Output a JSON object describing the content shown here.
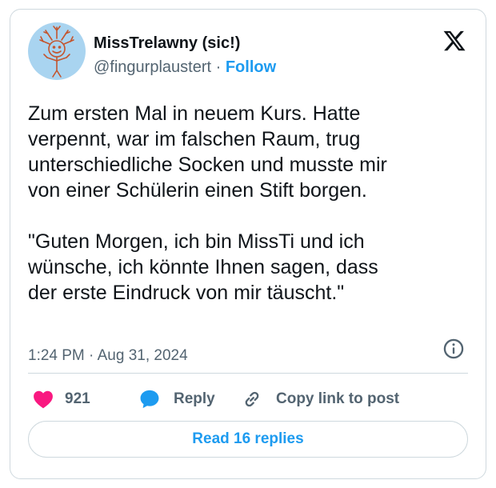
{
  "author": {
    "display_name": "MissTrelawny (sic!)",
    "handle": "@fingurplaustert",
    "separator": "·",
    "follow_label": "Follow"
  },
  "tweet": {
    "text": "Zum ersten Mal in neuem Kurs. Hatte\nverpennt, war im falschen Raum, trug\nunterschiedliche Socken und musste mir\nvon einer Schülerin einen Stift borgen.\n\n\"Guten Morgen, ich bin MissTi und ich\nwünsche, ich könnte Ihnen sagen, dass\nder erste Eindruck von mir täuscht.\"",
    "time": "1:24 PM",
    "date_separator": "·",
    "date": "Aug 31, 2024"
  },
  "actions": {
    "like_count": "921",
    "reply_label": "Reply",
    "copy_label": "Copy link to post"
  },
  "read_replies_label": "Read 16 replies",
  "icons": {
    "logo": "x-logo-icon",
    "info": "info-icon",
    "like": "heart-icon",
    "reply": "speech-bubble-icon",
    "copy": "link-icon"
  },
  "colors": {
    "accent": "#1d9bf0",
    "like": "#f91880",
    "secondary_text": "#536471",
    "border": "#cfd9de"
  }
}
